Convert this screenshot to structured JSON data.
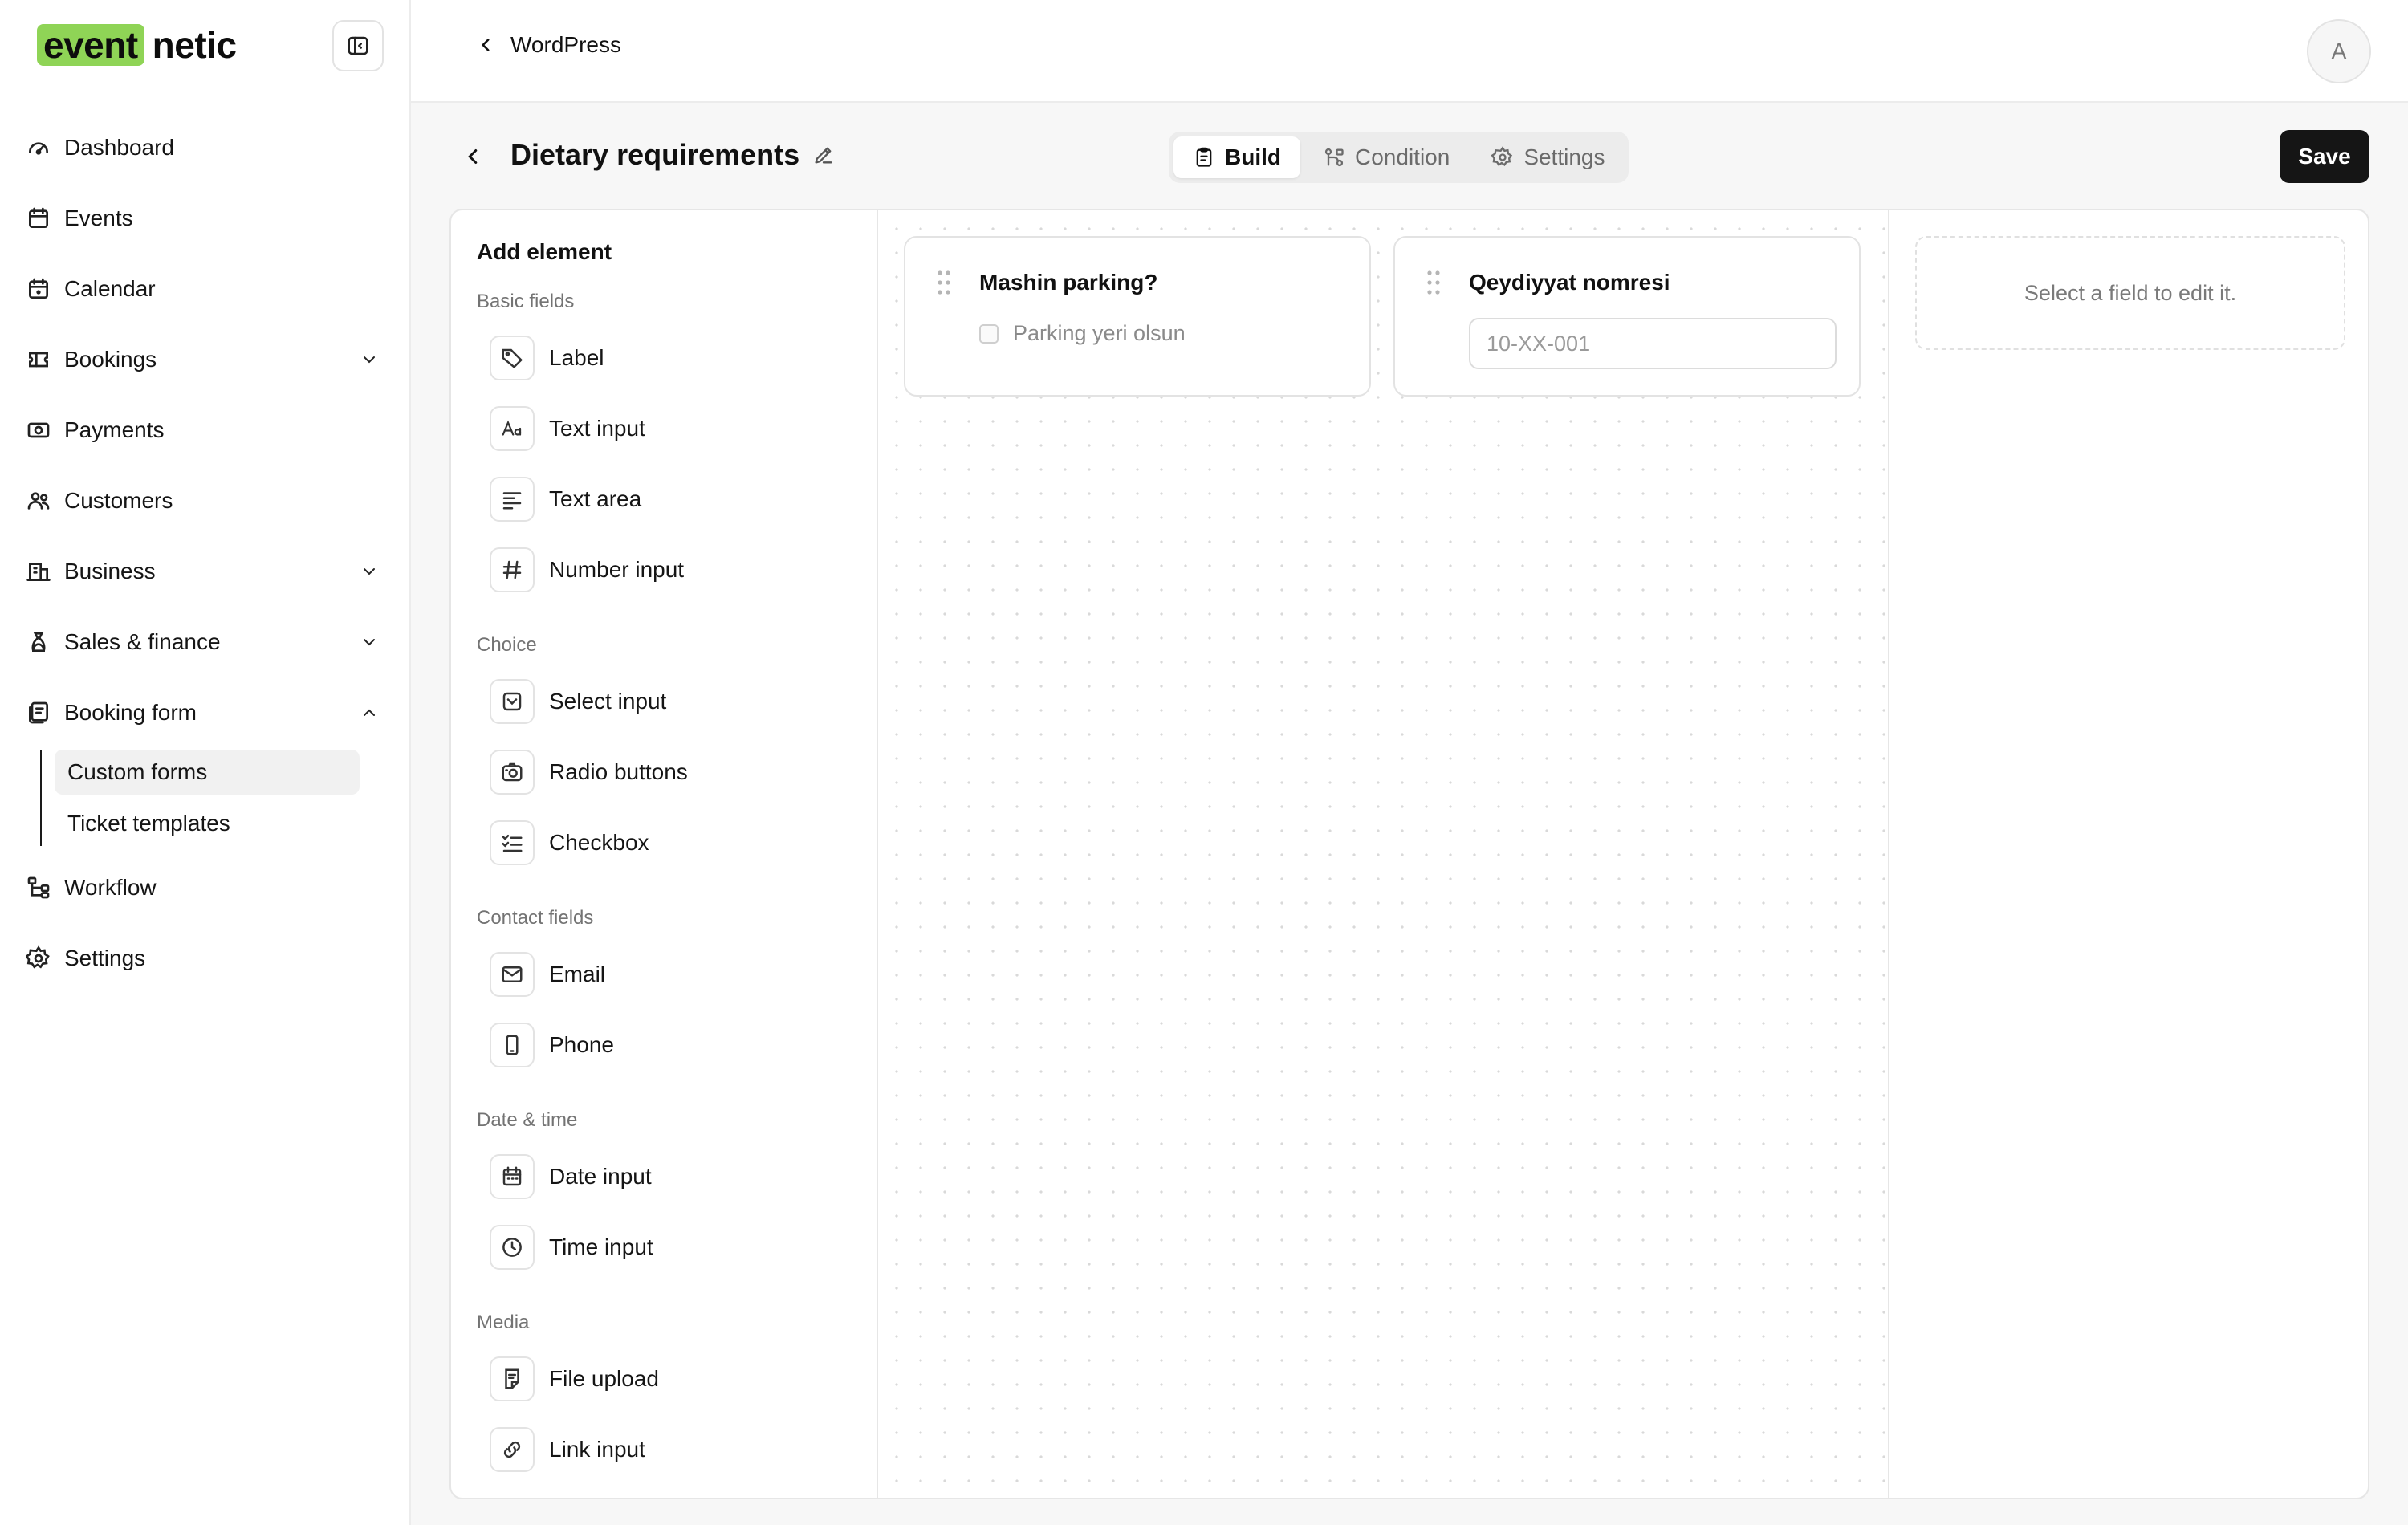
{
  "brand": {
    "logo_highlight": "event",
    "logo_rest": "netic",
    "accent": "#8fd456"
  },
  "sidebar": {
    "items": [
      {
        "label": "Dashboard",
        "icon": "dashboard-icon"
      },
      {
        "label": "Events",
        "icon": "calendar-icon"
      },
      {
        "label": "Calendar",
        "icon": "calendar-icon"
      },
      {
        "label": "Bookings",
        "icon": "bookings-icon",
        "expandable": true
      },
      {
        "label": "Payments",
        "icon": "payments-icon"
      },
      {
        "label": "Customers",
        "icon": "customers-icon"
      },
      {
        "label": "Business",
        "icon": "building-icon",
        "expandable": true
      },
      {
        "label": "Sales & finance",
        "icon": "finance-icon",
        "expandable": true
      },
      {
        "label": "Booking form",
        "icon": "form-icon",
        "expanded": true
      }
    ],
    "sub_items": [
      {
        "label": "Custom forms",
        "active": true
      },
      {
        "label": "Ticket templates"
      }
    ],
    "items_after": [
      {
        "label": "Workflow",
        "icon": "workflow-icon"
      },
      {
        "label": "Settings",
        "icon": "gear-icon"
      }
    ]
  },
  "topbar": {
    "breadcrumb": "WordPress",
    "avatar_initial": "A"
  },
  "header": {
    "title": "Dietary requirements",
    "tabs": [
      {
        "label": "Build",
        "active": true
      },
      {
        "label": "Condition"
      },
      {
        "label": "Settings"
      }
    ],
    "save_label": "Save"
  },
  "palette": {
    "title": "Add element",
    "groups": [
      {
        "label": "Basic fields",
        "items": [
          "Label",
          "Text input",
          "Text area",
          "Number input"
        ]
      },
      {
        "label": "Choice",
        "items": [
          "Select input",
          "Radio buttons",
          "Checkbox"
        ]
      },
      {
        "label": "Contact fields",
        "items": [
          "Email",
          "Phone"
        ]
      },
      {
        "label": "Date & time",
        "items": [
          "Date input",
          "Time input"
        ]
      },
      {
        "label": "Media",
        "items": [
          "File upload",
          "Link input"
        ]
      }
    ]
  },
  "canvas": {
    "fields": [
      {
        "label": "Mashin parking?",
        "type": "checkbox",
        "option": "Parking yeri olsun"
      },
      {
        "label": "Qeydiyyat nomresi",
        "type": "text",
        "placeholder": "10-XX-001"
      }
    ]
  },
  "properties": {
    "empty_text": "Select a field to edit it."
  }
}
